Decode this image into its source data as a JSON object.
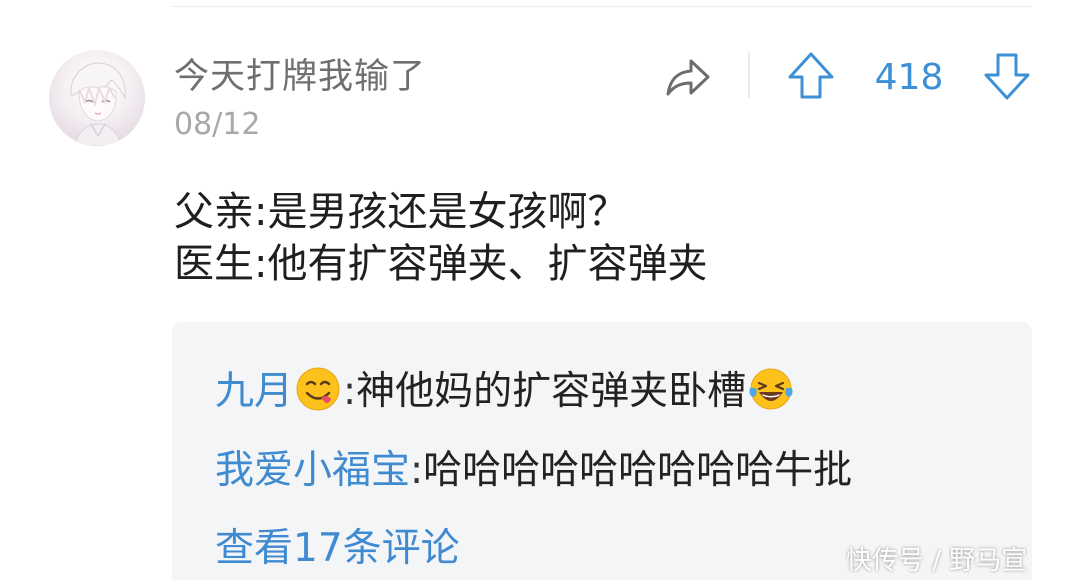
{
  "post": {
    "author": {
      "name": "今天打牌我输了",
      "avatar_icon": "anime-avatar"
    },
    "date": "08/12",
    "actions": {
      "share_icon": "share-arrow-icon",
      "upvote_icon": "arrow-up-icon",
      "vote_count": "418",
      "downvote_icon": "arrow-down-icon"
    },
    "body_lines": [
      "父亲:是男孩还是女孩啊？",
      "医生:他有扩容弹夹、扩容弹夹"
    ]
  },
  "comments": {
    "replies": [
      {
        "author": "九月",
        "author_emoji": "yum-face-emoji",
        "separator": ":",
        "text": "神他妈的扩容弹夹卧槽",
        "trailing_emoji": "laughing-tears-emoji"
      },
      {
        "author": "我爱小福宝",
        "separator": ":",
        "text": "哈哈哈哈哈哈哈哈哈牛批"
      }
    ],
    "view_more": "查看17条评论"
  },
  "watermark": "快传号 / 野马宣",
  "colors": {
    "accent": "#3f8ad0",
    "username": "#6f6f6f",
    "date": "#a8a8a8",
    "body_text": "#1f1f1f",
    "panel_bg": "#f4f5f7"
  }
}
